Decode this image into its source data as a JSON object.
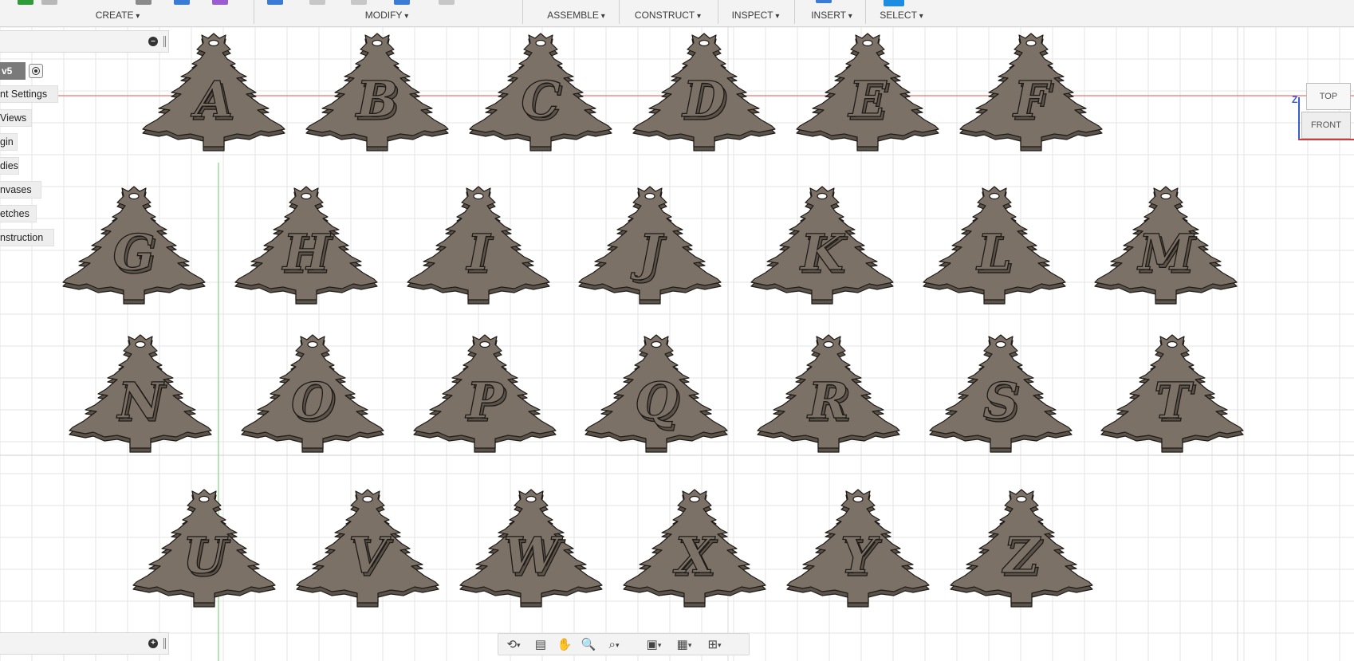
{
  "toolbar": {
    "groups": [
      {
        "label": "CREATE"
      },
      {
        "label": "MODIFY"
      },
      {
        "label": "ASSEMBLE"
      },
      {
        "label": "CONSTRUCT"
      },
      {
        "label": "INSPECT"
      },
      {
        "label": "INSERT"
      },
      {
        "label": "SELECT"
      }
    ]
  },
  "browser": {
    "root_version": "v5",
    "nodes": [
      {
        "label": "nt Settings"
      },
      {
        "label": "Views"
      },
      {
        "label": "gin"
      },
      {
        "label": "dies"
      },
      {
        "label": "nvases"
      },
      {
        "label": "etches"
      },
      {
        "label": "nstruction"
      }
    ]
  },
  "viewcube": {
    "top_label": "TOP",
    "front_label": "FRONT",
    "axis_label": "Z"
  },
  "ornaments": {
    "rows": [
      [
        "A",
        "B",
        "C",
        "D",
        "E",
        "F"
      ],
      [
        "G",
        "H",
        "I",
        "J",
        "K",
        "L",
        "M"
      ],
      [
        "N",
        "O",
        "P",
        "Q",
        "R",
        "S",
        "T"
      ],
      [
        "U",
        "V",
        "W",
        "X",
        "Y",
        "Z"
      ]
    ]
  },
  "colors": {
    "ornament_fill": "#7c7166",
    "ornament_stroke": "#1e1a17",
    "ornament_edge": "#5b5249",
    "grid_line": "#e6e6e6",
    "red_axis": "#e05050",
    "green_axis": "#6fc96f",
    "toolbar_bg": "#f3f3f3"
  },
  "icons": {
    "nav": [
      "orbit-icon",
      "look-at-icon",
      "pan-icon",
      "zoom-icon",
      "zoom-window-icon",
      "display-settings-icon",
      "grid-settings-icon",
      "viewports-icon"
    ]
  }
}
